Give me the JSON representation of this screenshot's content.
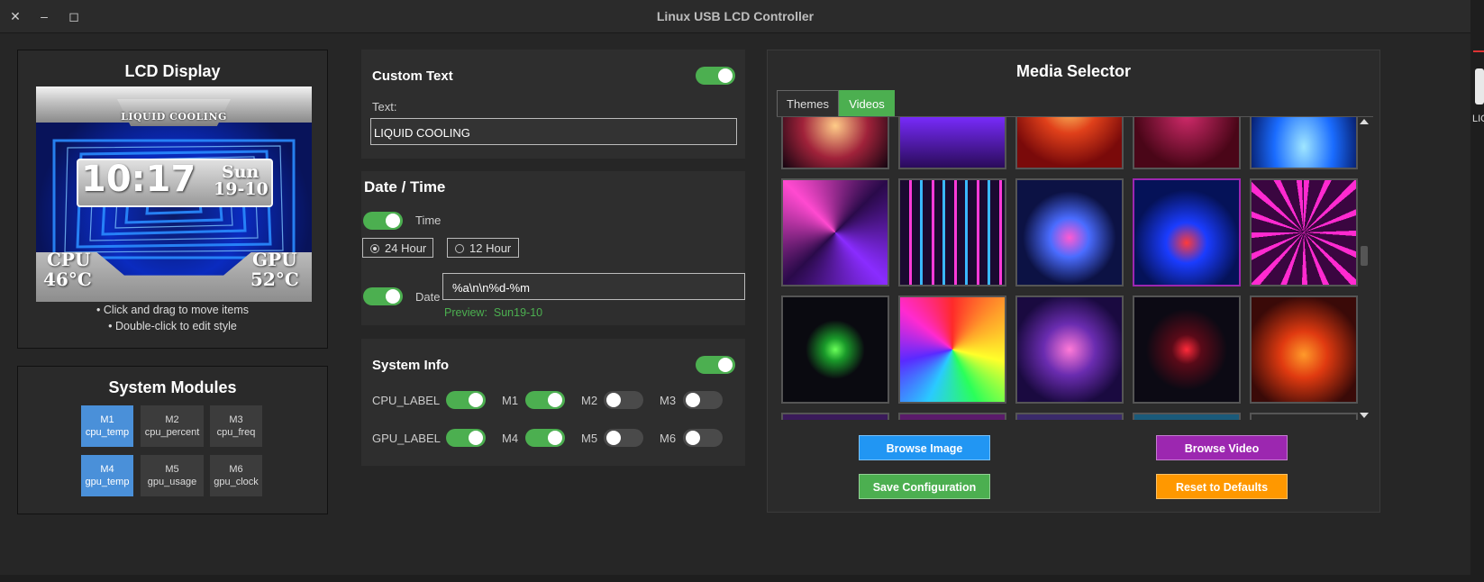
{
  "window": {
    "title": "Linux USB LCD Controller",
    "controls": {
      "close": "✕",
      "minimize": "–",
      "maximize": "◻"
    }
  },
  "side_label": "LIC",
  "lcd_panel": {
    "title": "LCD Display",
    "preview": {
      "banner": "LIQUID COOLING",
      "time": "10:17",
      "day": "Sun",
      "date": "19-10",
      "cpu_label": "CPU",
      "cpu_value": "46°C",
      "gpu_label": "GPU",
      "gpu_value": "52°C"
    },
    "hints": [
      "• Click and drag to move items",
      "• Double-click to edit style"
    ]
  },
  "modules_panel": {
    "title": "System Modules",
    "modules": [
      {
        "id": "M1",
        "name": "cpu_temp",
        "active": true
      },
      {
        "id": "M2",
        "name": "cpu_percent",
        "active": false
      },
      {
        "id": "M3",
        "name": "cpu_freq",
        "active": false
      },
      {
        "id": "M4",
        "name": "gpu_temp",
        "active": true
      },
      {
        "id": "M5",
        "name": "gpu_usage",
        "active": false
      },
      {
        "id": "M6",
        "name": "gpu_clock",
        "active": false
      }
    ]
  },
  "custom_text": {
    "title": "Custom Text",
    "enabled": true,
    "text_label": "Text:",
    "text_value": "LIQUID COOLING"
  },
  "datetime": {
    "title": "Date / Time",
    "time_enabled": true,
    "time_label": "Time",
    "radio_24": "24 Hour",
    "radio_12": "12 Hour",
    "selected_format": "24 Hour",
    "date_enabled": true,
    "date_label": "Date",
    "date_format": "%a\\n\\n%d-%m",
    "preview_label": "Preview:",
    "preview_value": "Sun19-10"
  },
  "system_info": {
    "title": "System Info",
    "enabled": true,
    "cpu_row_label": "CPU_LABEL",
    "gpu_row_label": "GPU_LABEL",
    "cpu_label_on": true,
    "gpu_label_on": true,
    "m_labels": {
      "m1": "M1",
      "m2": "M2",
      "m3": "M3",
      "m4": "M4",
      "m5": "M5",
      "m6": "M6"
    },
    "m_states": {
      "m1": true,
      "m2": false,
      "m3": false,
      "m4": true,
      "m5": false,
      "m6": false
    }
  },
  "media": {
    "title": "Media Selector",
    "tabs": [
      "Themes",
      "Videos"
    ],
    "active_tab": "Videos",
    "selected_thumbnail": 9,
    "buttons": {
      "browse_image": "Browse Image",
      "browse_video": "Browse Video",
      "save_config": "Save Configuration",
      "reset": "Reset to Defaults"
    },
    "colors": {
      "browse_image": "#2196f3",
      "browse_video": "#9c27b0",
      "save_config": "#4caf50",
      "reset": "#ff9800"
    }
  },
  "accent": "#4caf50"
}
